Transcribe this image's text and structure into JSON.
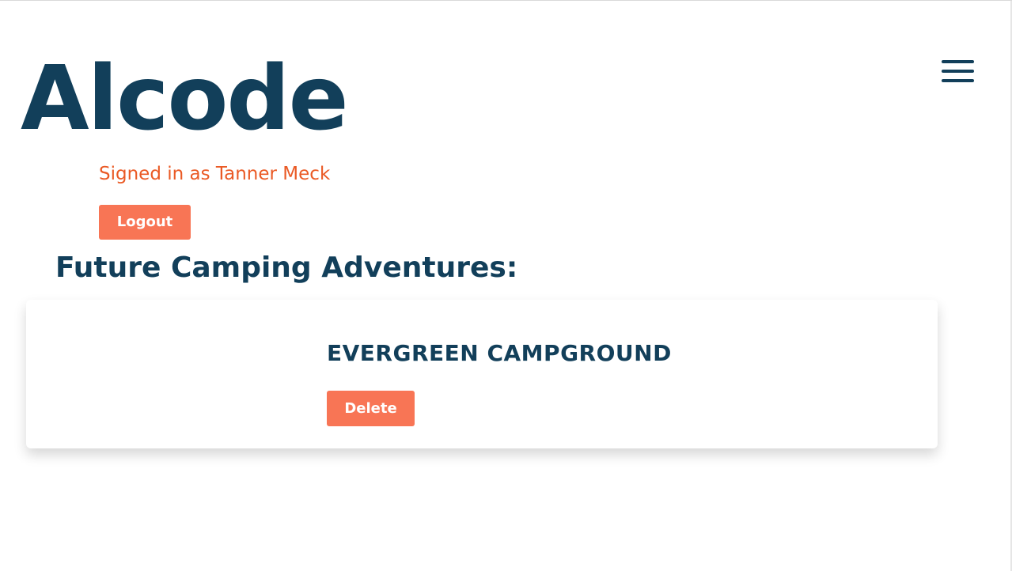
{
  "header": {
    "brand": "Alcode",
    "menu_icon": "hamburger-menu-icon"
  },
  "user": {
    "signed_in_text": "Signed in as Tanner Meck",
    "logout_label": "Logout"
  },
  "main": {
    "section_title": "Future Camping Adventures:",
    "trips": [
      {
        "name": "EVERGREEN CAMPGROUND",
        "delete_label": "Delete"
      }
    ]
  },
  "colors": {
    "primary": "#123f5a",
    "accent": "#f87555",
    "signed_in_text": "#ea5a25",
    "background": "#ffffff"
  }
}
